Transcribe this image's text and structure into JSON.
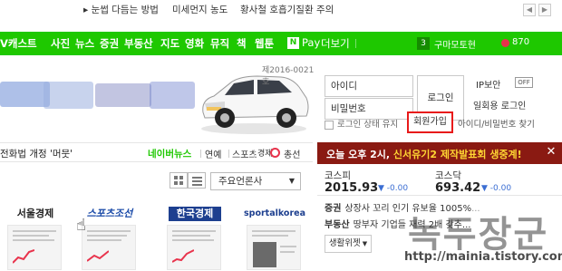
{
  "topbar": {
    "keywords": [
      "눈썹 다듬는 방법",
      "미세먼지 농도",
      "황사철 호흡기질환 주의"
    ]
  },
  "nav": {
    "items": [
      "V캐스트",
      "사진",
      "뉴스",
      "증권",
      "부동산",
      "지도",
      "영화",
      "뮤직",
      "책",
      "웹툰"
    ],
    "npay_icon": "N",
    "npay": "Pay",
    "more": "더보기",
    "count": "3",
    "user": "구마모토현",
    "coins": "870"
  },
  "banner": {
    "code": "제2016-0021호"
  },
  "login": {
    "id_placeholder": "아이디",
    "pw_placeholder": "비밀번호",
    "login_button": "로그인",
    "ip_label": "IP보안",
    "ip_state": "OFF",
    "one_time": "일회용 로그인",
    "keep_login": "로그인 상태 유지",
    "join": "회원가입",
    "find": "아이디/비밀번호 찾기"
  },
  "news": {
    "headline": "전화법 개정 '머뭇'",
    "brand": "네이버뉴스",
    "tabs": [
      "연예",
      "스포츠",
      "경제"
    ],
    "election": "총선"
  },
  "event": {
    "time": "오늘 오후 2시, ",
    "highlight": "신서유기2 제작발표회 생중계!",
    "close": "✕"
  },
  "press": {
    "select_label": "주요언론사",
    "logos": [
      "서울경제",
      "스포츠조선",
      "한국경제",
      "sportalkorea"
    ]
  },
  "stocks": {
    "kospi": {
      "name": "코스피",
      "value": "2015.93",
      "change": "-0.00"
    },
    "kosdaq": {
      "name": "코스닥",
      "value": "693.42",
      "change": "-0.00"
    }
  },
  "side_news": [
    {
      "tag": "증권",
      "text": "상장사 꼬리 인기 유보율 1005%",
      "more": "..."
    },
    {
      "tag": "부동산",
      "text": "땅부자 기업들 재력 2배 갖추...",
      "more": ""
    }
  ],
  "widget": {
    "label": "생활위젯"
  },
  "watermark": {
    "text": "녹두장군",
    "url": "http://mainia.tistory.com"
  },
  "colors": {
    "brand_green": "#1ec800",
    "event_bg": "#8a1a12",
    "highlight_yellow": "#ffd633",
    "join_border": "#e81a1a",
    "stock_change": "#3b6ed3"
  }
}
